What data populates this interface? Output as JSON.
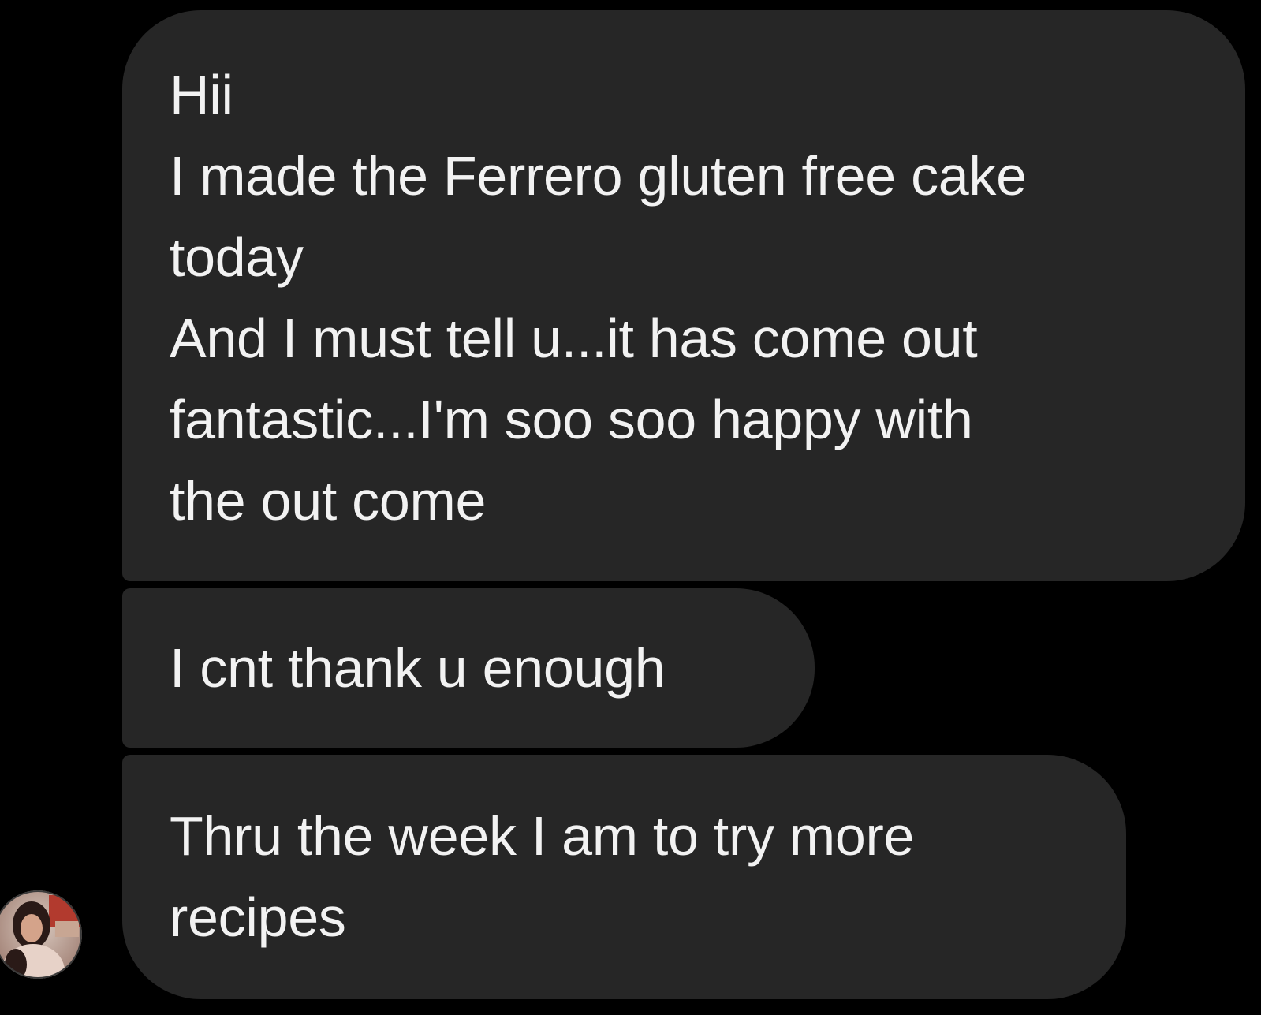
{
  "conversation": {
    "messages": [
      {
        "text": "Hii\nI made the Ferrero gluten free cake\ntoday\nAnd I must tell u...it has come out\nfantastic...I'm soo soo happy with\nthe out come"
      },
      {
        "text": "I cnt thank u enough"
      },
      {
        "text": "Thru the week I am to try more\nrecipes"
      }
    ],
    "sender_avatar": {
      "icon": "profile-photo"
    }
  },
  "colors": {
    "background": "#000000",
    "bubble": "#262626",
    "text": "#f2f2f2"
  }
}
